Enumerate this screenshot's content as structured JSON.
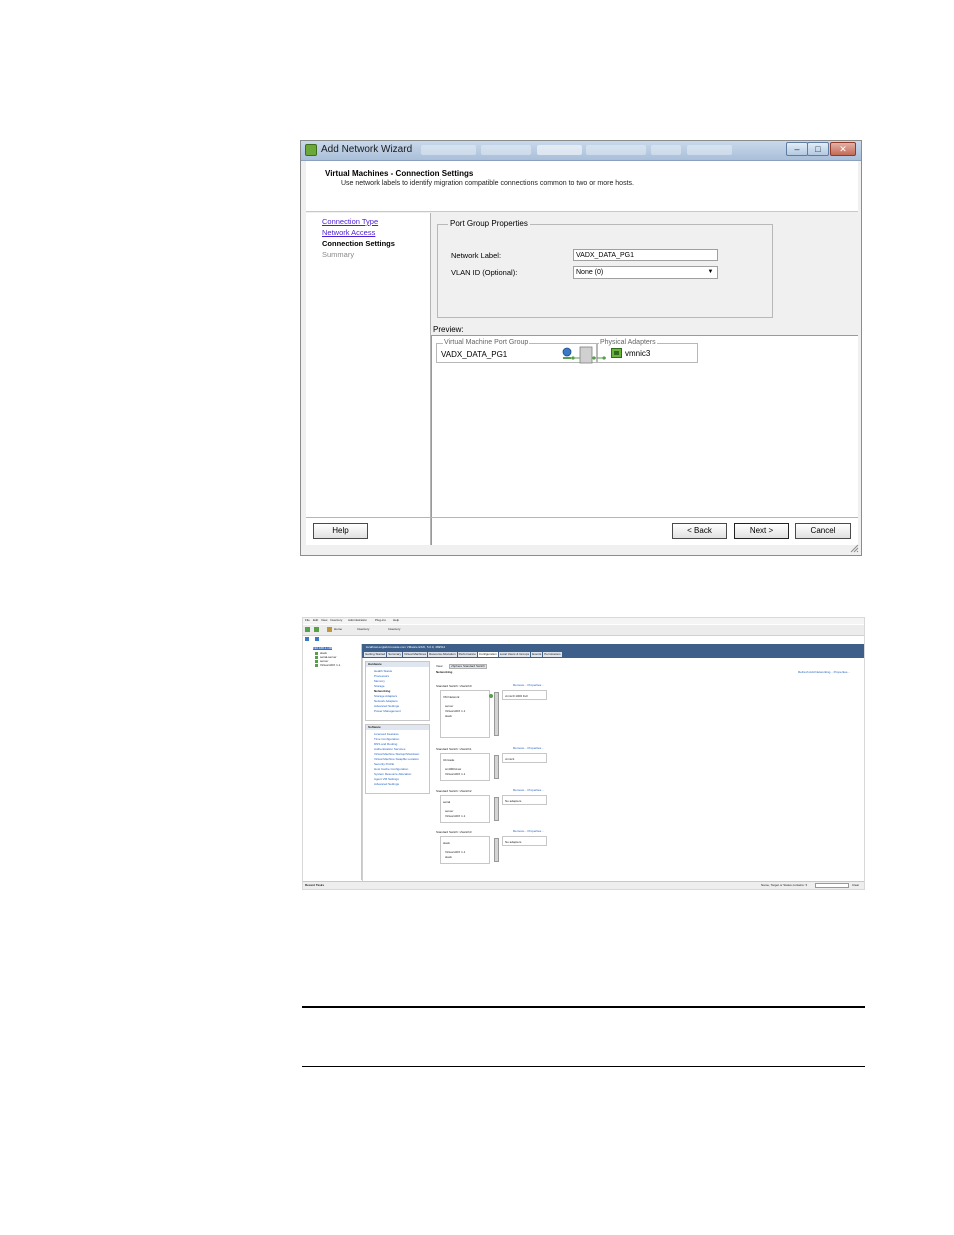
{
  "wizard": {
    "title": "Add Network Wizard",
    "window_buttons": {
      "minimize": "–",
      "maximize": "□",
      "close": "✕"
    },
    "header_title": "Virtual Machines - Connection Settings",
    "header_subtitle": "Use network labels to identify migration compatible connections common to two or more hosts.",
    "steps": [
      {
        "label": "Connection Type",
        "state": "done"
      },
      {
        "label": "Network Access",
        "state": "done"
      },
      {
        "label": "Connection Settings",
        "state": "current"
      },
      {
        "label": "Summary",
        "state": "pending"
      }
    ],
    "port_group_properties": {
      "legend": "Port Group Properties",
      "network_label_caption": "Network Label:",
      "network_label_value": "VADX_DATA_PG1",
      "vlan_caption": "VLAN ID (Optional):",
      "vlan_value": "None (0)"
    },
    "preview": {
      "caption": "Preview:",
      "vm_port_group_legend": "Virtual Machine Port Group",
      "vm_port_group_name": "VADX_DATA_PG1",
      "physical_adapters_legend": "Physical Adapters",
      "physical_adapter_name": "vmnic3"
    },
    "buttons": {
      "help": "Help",
      "back": "< Back",
      "next": "Next >",
      "cancel": "Cancel"
    },
    "colors": {
      "link": "#4b1fd3",
      "titlebar": "#b8cbe3",
      "green_icon": "#56a04b"
    }
  },
  "vsphere": {
    "menu": [
      "File",
      "Edit",
      "View",
      "Inventory",
      "Administration",
      "Plug-ins",
      "Help"
    ],
    "toolbar": {
      "home": "Home",
      "inventory1": "Inventory",
      "inventory2": "Inventory"
    },
    "tree": [
      "192.168.1.100",
      "slack",
      "serial-server",
      "server",
      "Virtual ADX 1.1"
    ],
    "host_title": "localhost.englab.brocade.com VMware ESXi, 5.0.0, 469512",
    "tabs": [
      "Getting Started",
      "Summary",
      "Virtual Machines",
      "Resource Allocation",
      "Performance",
      "Configuration",
      "Local Users & Groups",
      "Events",
      "Permissions"
    ],
    "hardware_header": "Hardware",
    "hardware_items": [
      "Health Status",
      "Processors",
      "Memory",
      "Storage",
      "Networking",
      "Storage Adapters",
      "Network Adapters",
      "Advanced Settings",
      "Power Management"
    ],
    "software_header": "Software",
    "software_items": [
      "Licensed Features",
      "Time Configuration",
      "DNS and Routing",
      "Authentication Services",
      "Virtual Machine Startup/Shutdown",
      "Virtual Machine Swapfile Location",
      "Security Profile",
      "Host Cache Configuration",
      "System Resource Allocation",
      "Agent VM Settings",
      "Advanced Settings"
    ],
    "view_label": "View:",
    "view_tab": "vSphere Standard Switch",
    "networking_title": "Networking",
    "top_links": "Refresh   Add Networking...   Properties...",
    "switches": [
      {
        "title": "Standard Switch: vSwitch0",
        "pg": "VM Network",
        "adapter": "vmnic0  1000  Full",
        "vms": [
          "server",
          "Virtual ADX 1.1",
          "slack"
        ]
      },
      {
        "title": "Standard Switch: vSwitch1",
        "pg": "Ubrcade",
        "adapter": "vmnic1",
        "vms": [
          "sn4000d-sw",
          "Virtual ADX 1.1"
        ]
      },
      {
        "title": "Standard Switch: vSwitch2",
        "pg": "serial",
        "adapter": "No adapters",
        "vms": [
          "server",
          "Virtual ADX 1.1"
        ]
      },
      {
        "title": "Standard Switch: vSwitch3",
        "pg": "slack",
        "adapter": "No adapters",
        "vms": [
          "Virtual ADX 1.1",
          "slack"
        ]
      }
    ],
    "switch_links": "Remove...   Properties...",
    "recent_tasks": "Recent Tasks",
    "status_right": "Name, Target or Status contains: ▾",
    "clear": "Clear"
  }
}
